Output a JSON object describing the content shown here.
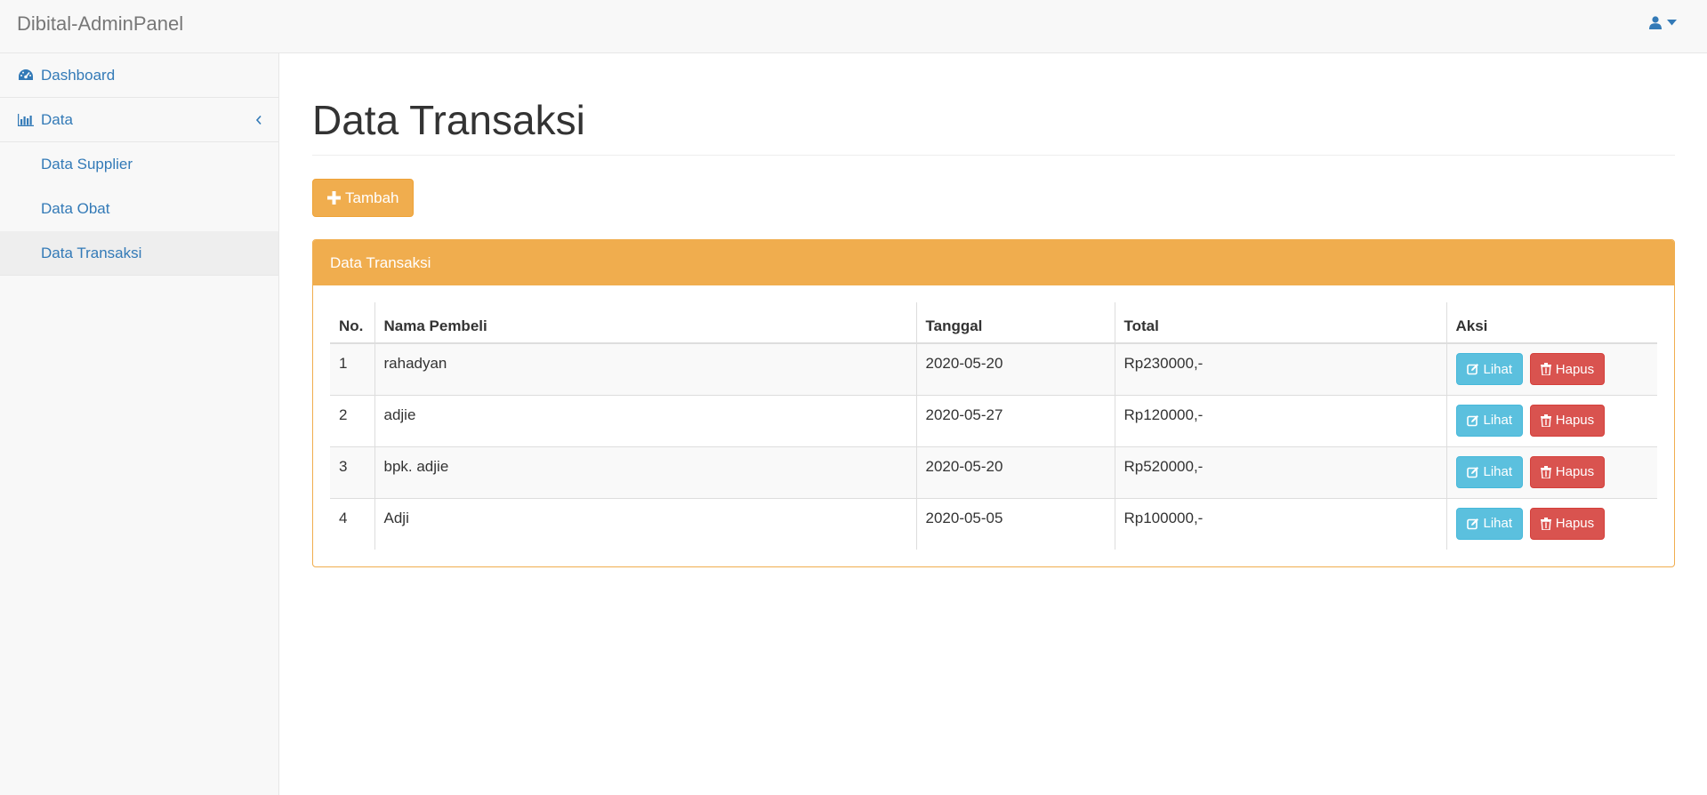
{
  "app": {
    "brand": "Dibital-AdminPanel"
  },
  "sidebar": {
    "items": [
      {
        "label": "Dashboard",
        "icon": "dashboard-icon"
      },
      {
        "label": "Data",
        "icon": "bar-chart-icon"
      }
    ],
    "subitems": [
      {
        "label": "Data Supplier"
      },
      {
        "label": "Data Obat"
      },
      {
        "label": "Data Transaksi"
      }
    ]
  },
  "main": {
    "title": "Data Transaksi",
    "add_label": "Tambah",
    "panel_title": "Data Transaksi",
    "table": {
      "headers": [
        "No.",
        "Nama Pembeli",
        "Tanggal",
        "Total",
        "Aksi"
      ],
      "rows": [
        {
          "no": "1",
          "nama": "rahadyan",
          "tanggal": "2020-05-20",
          "total": "Rp230000,-"
        },
        {
          "no": "2",
          "nama": "adjie",
          "tanggal": "2020-05-27",
          "total": "Rp120000,-"
        },
        {
          "no": "3",
          "nama": "bpk. adjie",
          "tanggal": "2020-05-20",
          "total": "Rp520000,-"
        },
        {
          "no": "4",
          "nama": "Adji",
          "tanggal": "2020-05-05",
          "total": "Rp100000,-"
        }
      ],
      "view_label": "Lihat",
      "delete_label": "Hapus"
    }
  },
  "colors": {
    "primary_link": "#337ab7",
    "warning": "#f0ad4e",
    "info": "#5bc0de",
    "danger": "#d9534f"
  }
}
